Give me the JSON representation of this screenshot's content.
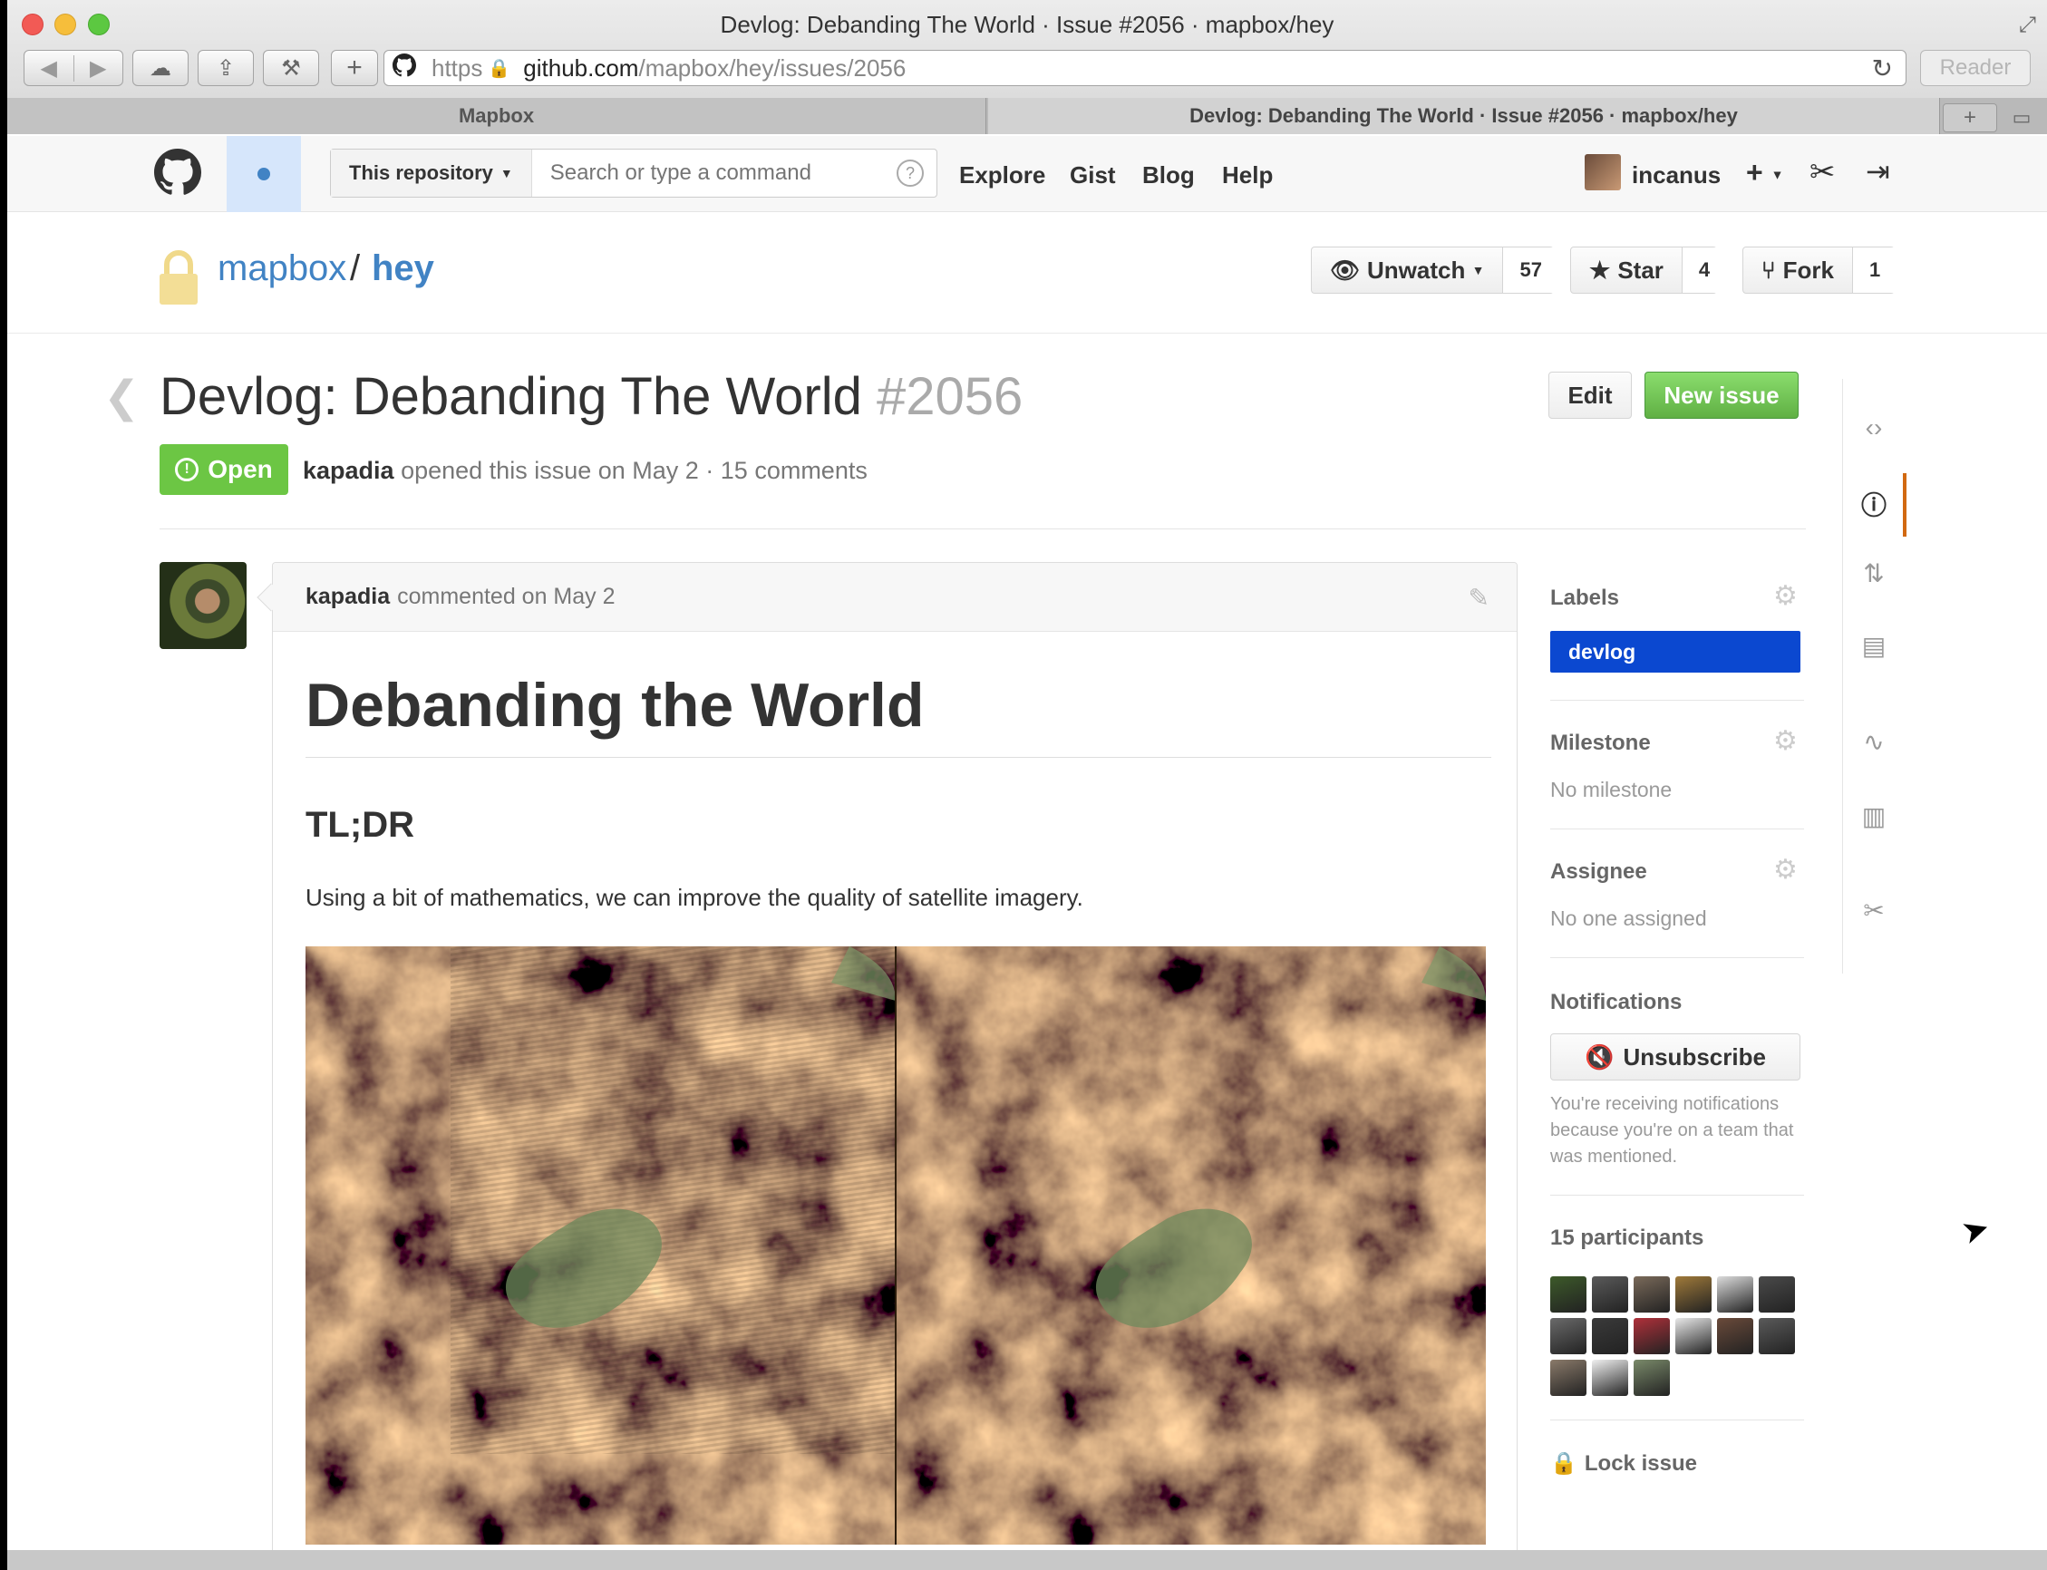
{
  "window": {
    "title": "Devlog: Debanding The World · Issue #2056 · mapbox/hey",
    "reader_label": "Reader"
  },
  "address": {
    "scheme": "https",
    "host": "github.com",
    "path": "/mapbox/hey/issues/2056"
  },
  "tabs": [
    {
      "label": "Mapbox"
    },
    {
      "label": "Devlog: Debanding The World · Issue #2056 · mapbox/hey"
    }
  ],
  "header": {
    "scope_label": "This repository",
    "search_placeholder": "Search or type a command",
    "nav": [
      "Explore",
      "Gist",
      "Blog",
      "Help"
    ],
    "username": "incanus",
    "create_label": "+"
  },
  "repo": {
    "owner": "mapbox",
    "separator": "/",
    "name": "hey",
    "watch_label": "Unwatch",
    "watch_count": "57",
    "star_label": "Star",
    "star_count": "4",
    "fork_label": "Fork",
    "fork_count": "1"
  },
  "issue": {
    "title": "Devlog: Debanding The World",
    "number": "#2056",
    "state": "Open",
    "author": "kapadia",
    "meta": "opened this issue on May 2 · 15 comments",
    "edit_label": "Edit",
    "new_issue_label": "New issue"
  },
  "comment": {
    "author": "kapadia",
    "meta": "commented on May 2",
    "heading": "Debanding the World",
    "subheading": "TL;DR",
    "text": "Using a bit of mathematics, we can improve the quality of satellite imagery."
  },
  "sidebar": {
    "labels_title": "Labels",
    "labels": [
      {
        "name": "devlog",
        "color": "#0b48d0"
      }
    ],
    "milestone_title": "Milestone",
    "milestone_value": "No milestone",
    "assignee_title": "Assignee",
    "assignee_value": "No one assigned",
    "notifications_title": "Notifications",
    "unsubscribe_label": "Unsubscribe",
    "notifications_text": "You're receiving notifications because you're on a team that was mentioned.",
    "participants_title": "15 participants",
    "participant_count": 15,
    "lock_label": "Lock issue"
  },
  "icons": [
    "github-mark",
    "lock",
    "eye",
    "star",
    "fork",
    "alert",
    "pencil",
    "gear",
    "mute",
    "code",
    "pull-request",
    "book",
    "pulse",
    "graph",
    "tools"
  ],
  "colors": {
    "link": "#4183c4",
    "open_green": "#6cc644",
    "new_issue_green": "#60b044",
    "label_devlog": "#0b48d0",
    "repo_nav_active": "#d26911"
  }
}
